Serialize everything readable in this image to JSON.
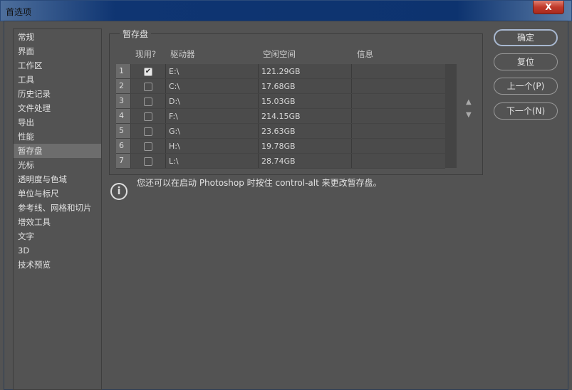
{
  "window": {
    "title": "首选项",
    "close": "X"
  },
  "sidebar": {
    "items": [
      "常规",
      "界面",
      "工作区",
      "工具",
      "历史记录",
      "文件处理",
      "导出",
      "性能",
      "暂存盘",
      "光标",
      "透明度与色域",
      "单位与标尺",
      "参考线、网格和切片",
      "增效工具",
      "文字",
      "3D",
      "技术预览"
    ],
    "selected": 8
  },
  "scratch": {
    "title": "暂存盘",
    "headers": {
      "active": "现用?",
      "drive": "驱动器",
      "free": "空闲空间",
      "info": "信息"
    },
    "rows": [
      {
        "n": "1",
        "checked": true,
        "drive": "E:\\",
        "free": "121.29GB",
        "info": ""
      },
      {
        "n": "2",
        "checked": false,
        "drive": "C:\\",
        "free": "17.68GB",
        "info": ""
      },
      {
        "n": "3",
        "checked": false,
        "drive": "D:\\",
        "free": "15.03GB",
        "info": ""
      },
      {
        "n": "4",
        "checked": false,
        "drive": "F:\\",
        "free": "214.15GB",
        "info": ""
      },
      {
        "n": "5",
        "checked": false,
        "drive": "G:\\",
        "free": "23.63GB",
        "info": ""
      },
      {
        "n": "6",
        "checked": false,
        "drive": "H:\\",
        "free": "19.78GB",
        "info": ""
      },
      {
        "n": "7",
        "checked": false,
        "drive": "L:\\",
        "free": "28.74GB",
        "info": ""
      }
    ],
    "up": "▲",
    "down": "▼"
  },
  "note": "您还可以在启动 Photoshop 时按住 control-alt 来更改暂存盘。",
  "buttons": {
    "ok": "确定",
    "reset": "复位",
    "prev": "上一个(P)",
    "next": "下一个(N)"
  }
}
